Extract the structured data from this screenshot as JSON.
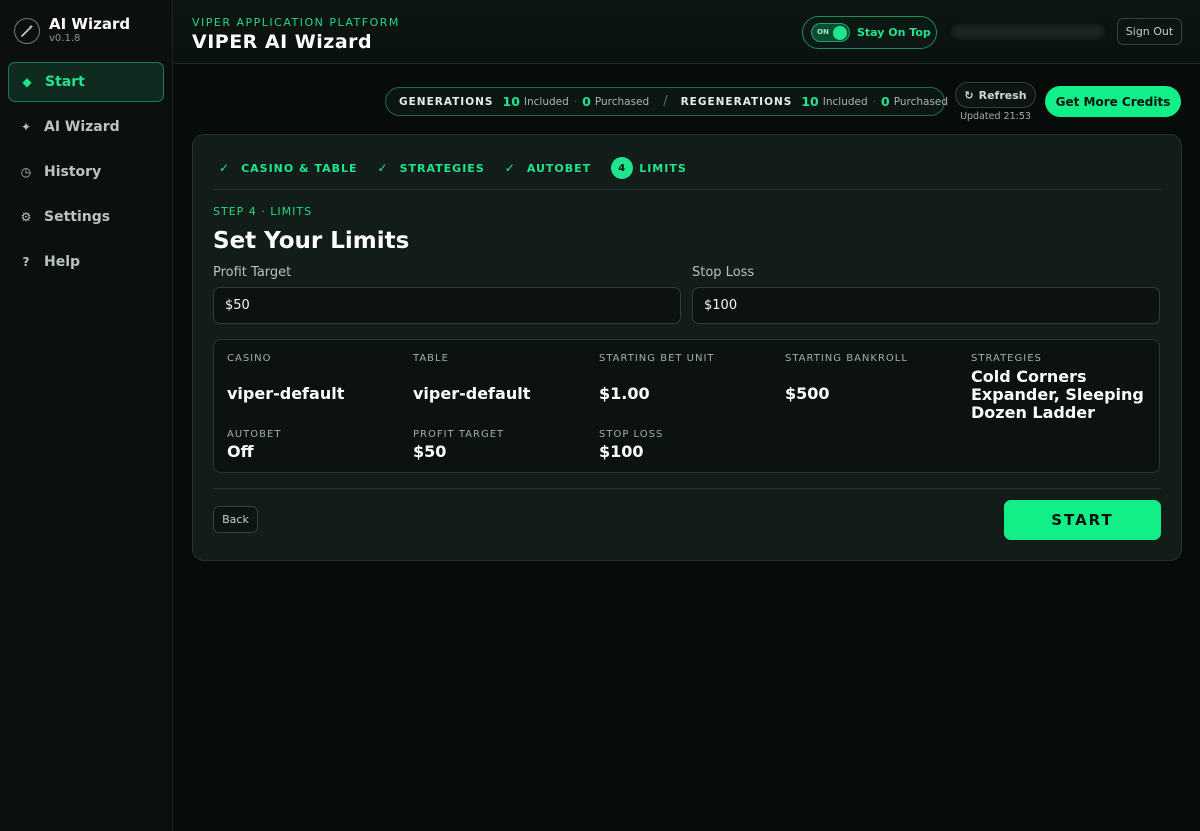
{
  "sidebar": {
    "brand_title": "AI Wizard",
    "version": "v0.1.8",
    "items": [
      {
        "label": "Start",
        "icon": "diamond-icon",
        "active": true
      },
      {
        "label": "AI Wizard",
        "icon": "sparkle-icon",
        "active": false
      },
      {
        "label": "History",
        "icon": "clock-icon",
        "active": false
      },
      {
        "label": "Settings",
        "icon": "gear-icon",
        "active": false
      },
      {
        "label": "Help",
        "icon": "question-icon",
        "active": false
      }
    ]
  },
  "header": {
    "platform": "VIPER APPLICATION PLATFORM",
    "title": "VIPER AI Wizard",
    "toggle_state": "ON",
    "stay_on_top": "Stay On Top",
    "sign_out": "Sign Out"
  },
  "credits": {
    "generations_label": "GENERATIONS",
    "generations_included": "10",
    "generations_purchased": "0",
    "regenerations_label": "REGENERATIONS",
    "regenerations_included": "10",
    "regenerations_purchased": "0",
    "included_word": "Included",
    "purchased_word": "Purchased",
    "refresh": "Refresh",
    "updated": "Updated 21:53",
    "get_more": "Get More Credits"
  },
  "steps": [
    {
      "label": "CASINO & TABLE",
      "done": true
    },
    {
      "label": "STRATEGIES",
      "done": true
    },
    {
      "label": "AUTOBET",
      "done": true
    },
    {
      "label": "LIMITS",
      "number": "4",
      "done": false
    }
  ],
  "form": {
    "step_caption": "STEP 4 · LIMITS",
    "title": "Set Your Limits",
    "profit_label": "Profit Target",
    "profit_value": "$50",
    "stop_label": "Stop Loss",
    "stop_value": "$100"
  },
  "summary": {
    "casino_label": "CASINO",
    "casino": "viper-default",
    "table_label": "TABLE",
    "table": "viper-default",
    "bet_unit_label": "STARTING BET UNIT",
    "bet_unit": "$1.00",
    "bankroll_label": "STARTING BANKROLL",
    "bankroll": "$500",
    "strategies_label": "STRATEGIES",
    "strategies": "Cold Corners Expander, Sleeping Dozen Ladder",
    "autobet_label": "AUTOBET",
    "autobet": "Off",
    "profit_label": "PROFIT TARGET",
    "profit": "$50",
    "stop_label": "STOP LOSS",
    "stop": "$100"
  },
  "actions": {
    "back": "Back",
    "start": "START"
  },
  "colors": {
    "accent": "#1fe58c",
    "background": "#070b0a",
    "card": "#121c19"
  }
}
